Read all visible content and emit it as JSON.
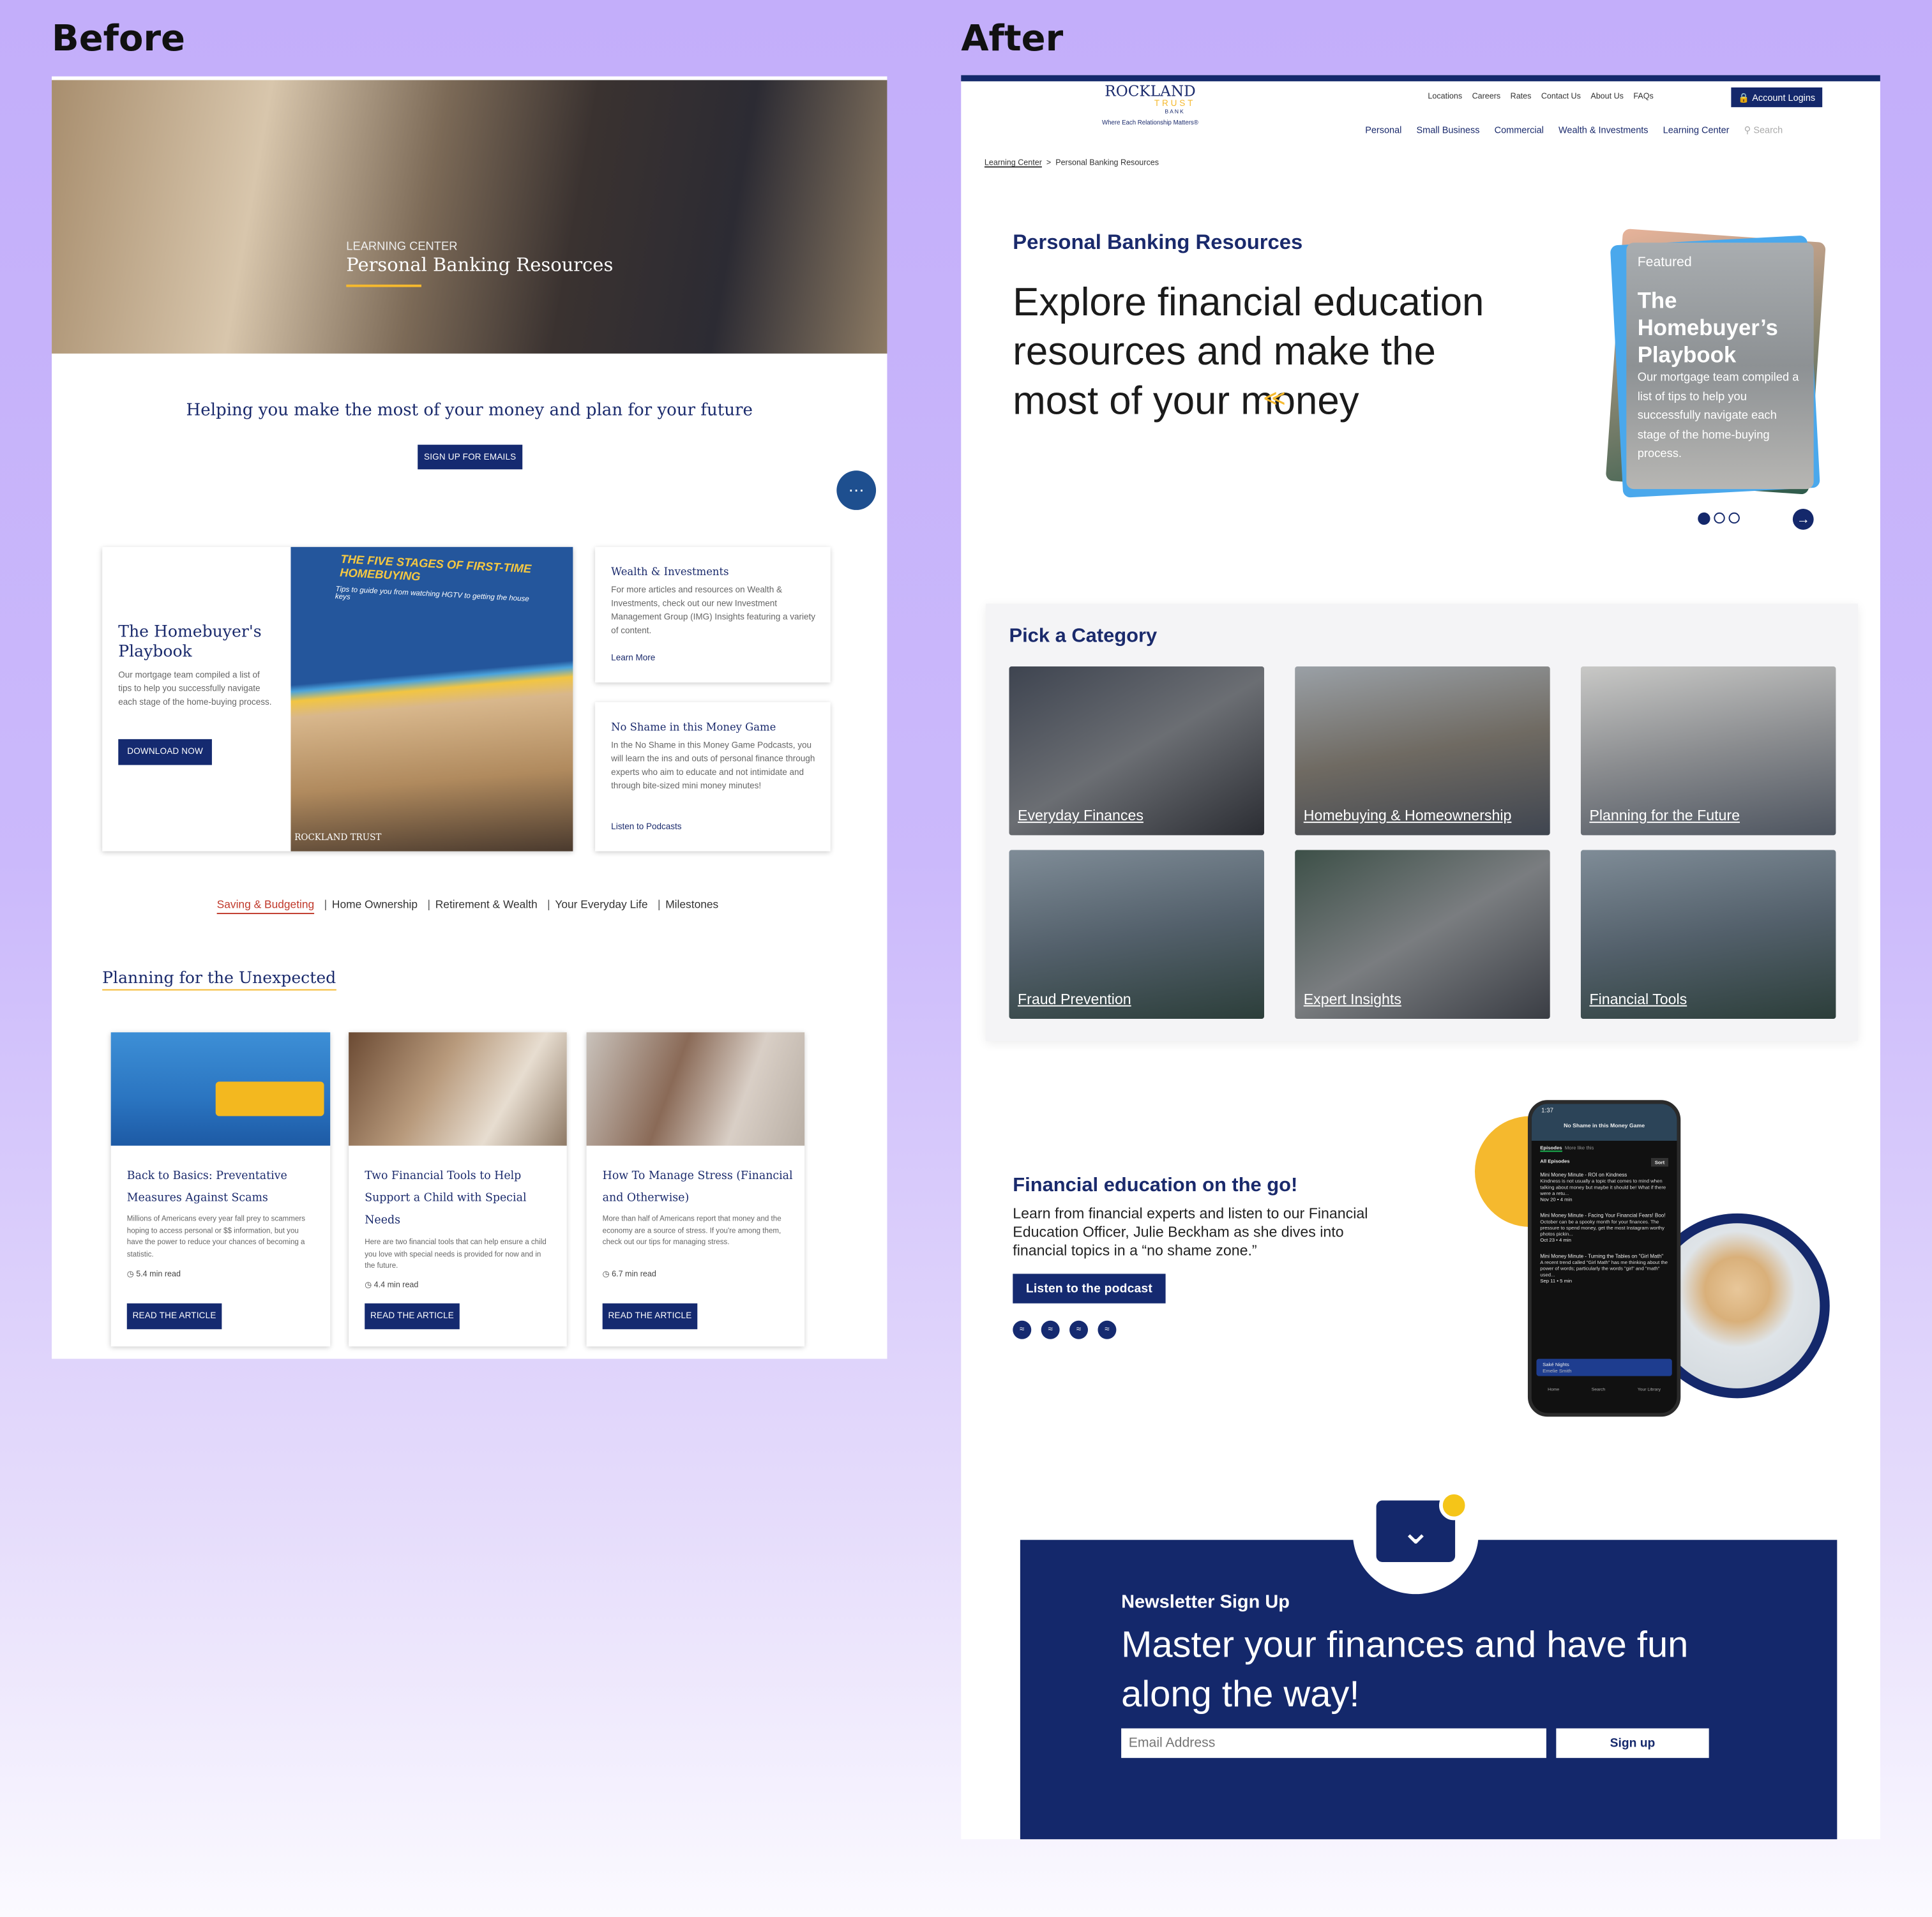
{
  "labels": {
    "before": "Before",
    "after": "After"
  },
  "before": {
    "hero": {
      "eyebrow": "LEARNING CENTER",
      "title": "Personal Banking Resources"
    },
    "tagline": "Helping you make the most of your money and plan for your future",
    "signup_button": "SIGN UP FOR EMAILS",
    "playbook": {
      "title": "The Homebuyer's Playbook",
      "text": "Our mortgage team compiled a list of tips to help you successfully navigate each stage of the home-buying process.",
      "button": "DOWNLOAD NOW",
      "cover_title": "THE FIVE STAGES OF FIRST-TIME HOMEBUYING",
      "cover_sub": "Tips to guide you from watching HGTV to getting the house keys",
      "cover_logo": "ROCKLAND TRUST"
    },
    "side_cards": [
      {
        "title": "Wealth & Investments",
        "text": "For more articles and resources on Wealth & Investments, check out our new Investment Management Group (IMG) Insights featuring a variety of content.",
        "link": "Learn More"
      },
      {
        "title": "No Shame in this Money Game",
        "text": "In the No Shame in this Money Game Podcasts, you will learn the ins and outs of personal finance through experts who aim to educate and not intimidate and through bite-sized mini money minutes!",
        "link": "Listen to Podcasts"
      }
    ],
    "tabs": [
      "Saving & Budgeting",
      "Home Ownership",
      "Retirement & Wealth",
      "Your Everyday Life",
      "Milestones"
    ],
    "active_tab": "Saving & Budgeting",
    "section_title": "Planning for the Unexpected",
    "articles": [
      {
        "title": "Back to Basics: Preventative Measures Against Scams",
        "text": "Millions of Americans every year fall prey to scammers hoping to access personal or $$ information, but you have the power to reduce your chances of becoming a statistic.",
        "read": "5.4 min read",
        "button": "READ THE ARTICLE"
      },
      {
        "title": "Two Financial Tools to Help Support a Child with Special Needs",
        "text": "Here are two financial tools that can help ensure a child you love with special needs is provided for now and in the future.",
        "read": "4.4 min read",
        "button": "READ THE ARTICLE"
      },
      {
        "title": "How To Manage Stress (Financial and Otherwise)",
        "text": "More than half of Americans report that money and the economy are a source of stress. If you're among them, check out our tips for managing stress.",
        "read": "6.7 min read",
        "button": "READ THE ARTICLE"
      }
    ]
  },
  "after": {
    "logo": {
      "name": "ROCKLAND",
      "sub": "TRUST",
      "bank": "BANK",
      "tagline": "Where Each Relationship Matters®"
    },
    "top_links": [
      "Locations",
      "Careers",
      "Rates",
      "Contact Us",
      "About Us",
      "FAQs"
    ],
    "account_button": "Account Logins",
    "main_nav": [
      "Personal",
      "Small Business",
      "Commercial",
      "Wealth & Investments",
      "Learning Center"
    ],
    "search_placeholder": "Search",
    "breadcrumb": [
      "Learning Center",
      "Personal Banking Resources"
    ],
    "intro": {
      "eyebrow": "Personal Banking Resources",
      "headline": "Explore financial education resources and make the most of your money"
    },
    "featured": {
      "tag": "Featured",
      "title": "The Homebuyer’s Playbook",
      "text": "Our mortgage team compiled a list of tips to help you successfully navigate each stage of the home-buying process.",
      "slides": 3,
      "active_slide": 1
    },
    "categories": {
      "title": "Pick a Category",
      "items": [
        "Everyday Finances",
        "Homebuying & Homeownership",
        "Planning for the Future",
        "Fraud Prevention",
        "Expert Insights",
        "Financial Tools"
      ]
    },
    "podcast": {
      "title": "Financial education on the go!",
      "text": "Learn from financial experts and listen to our Financial Education Officer, Julie Beckham as she dives into financial topics in a “no shame zone.”",
      "button": "Listen to the podcast",
      "icons": [
        "spotify-icon",
        "spotify-icon",
        "spotify-icon",
        "spotify-icon"
      ]
    },
    "phone": {
      "time": "1:37",
      "title": "No Shame in this Money Game",
      "tabs": [
        "Episodes",
        "More like this"
      ],
      "all": "All Episodes",
      "sort": "Sort",
      "episodes": [
        {
          "title": "Mini Money Minute - ROI on Kindness",
          "desc": "Kindness is not usually a topic that comes to mind when talking about money but maybe it should be! What if there were a retu...",
          "meta": "Nov 20 • 4 min"
        },
        {
          "title": "Mini Money Minute - Facing Your Financial Fears! Boo!",
          "desc": "October can be a spooky month for your finances. The pressure to spend money, get the most Instagram worthy photos pickin...",
          "meta": "Oct 23 • 4 min"
        },
        {
          "title": "Mini Money Minute - Turning the Tables on \"Girl Math\"",
          "desc": "A recent trend called \"Girl Math\" has me thinking about the power of words; particularly the words \"girl\" and \"math\" used...",
          "meta": "Sep 11 • 5 min"
        }
      ],
      "now_playing": {
        "track": "Saké Nights",
        "artist": "Emelie Smith"
      },
      "bottom_nav": [
        "Home",
        "Search",
        "Your Library"
      ]
    },
    "newsletter": {
      "eyebrow": "Newsletter Sign Up",
      "headline": "Master your finances and have fun along the way!",
      "placeholder": "Email Address",
      "button": "Sign up"
    }
  },
  "colors": {
    "navy": "#152a70",
    "gold": "#f5b92e",
    "tab_active": "#c0392b"
  }
}
